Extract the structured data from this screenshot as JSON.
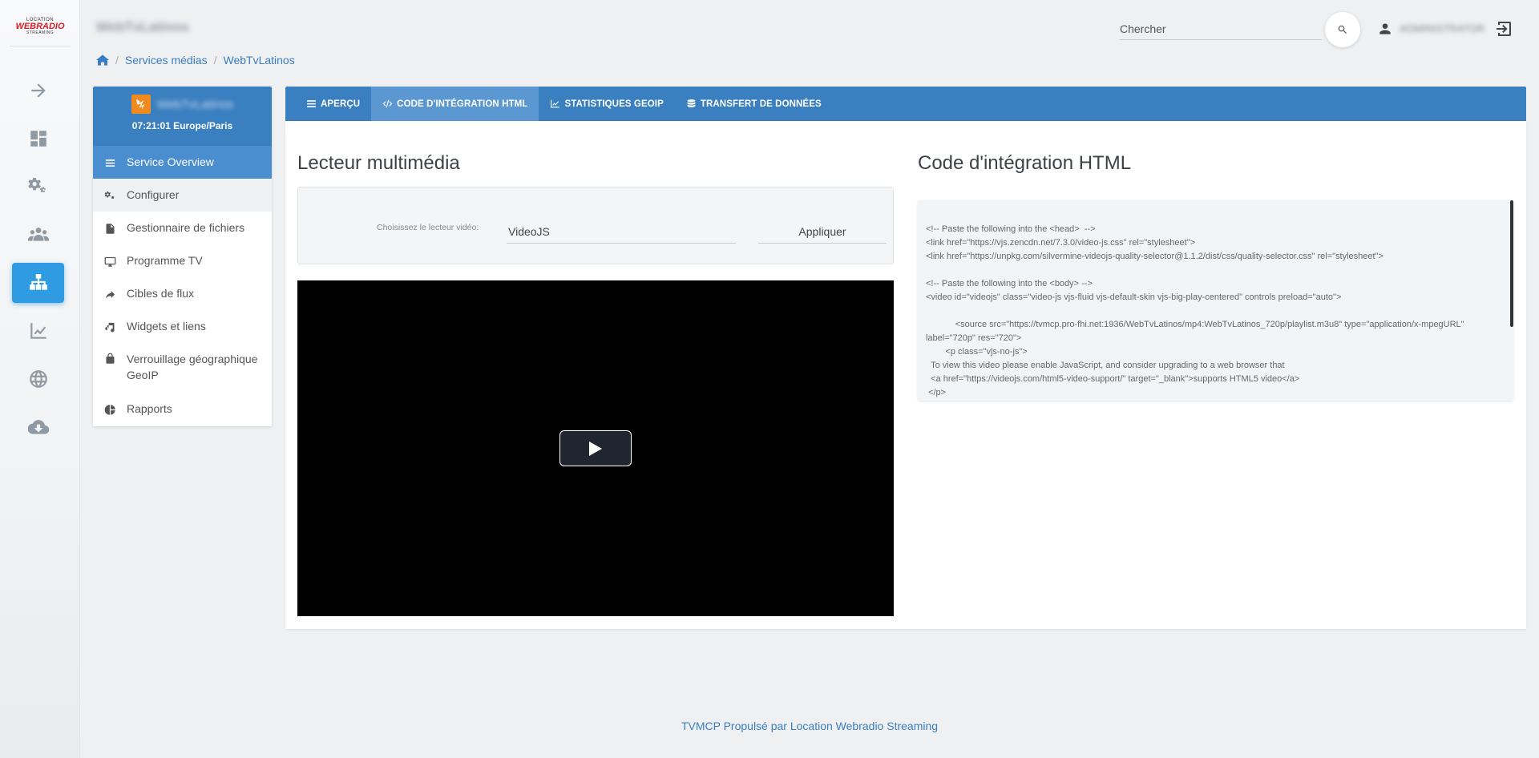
{
  "logo": {
    "line1": "LOCATION",
    "line2": "WEBRADIO",
    "line3": "STREAMING"
  },
  "header": {
    "brand": "WebTvLatinos",
    "search_placeholder": "Chercher",
    "user": "ADMINISTRATOR"
  },
  "breadcrumb": {
    "items": [
      "Services médias",
      "WebTvLatinos"
    ]
  },
  "service": {
    "name": "WebTvLatinos",
    "time": "07:21:01 Europe/Paris",
    "menu": [
      {
        "label": "Service Overview"
      },
      {
        "label": "Configurer"
      },
      {
        "label": "Gestionnaire de fichiers"
      },
      {
        "label": "Programme TV"
      },
      {
        "label": "Cibles de flux"
      },
      {
        "label": "Widgets et liens"
      },
      {
        "label": "Verrouillage géographique GeoIP"
      },
      {
        "label": "Rapports"
      }
    ]
  },
  "tabs": [
    {
      "label": "APERÇU",
      "icon": "list-icon"
    },
    {
      "label": "CODE D'INTÉGRATION HTML",
      "icon": "code-icon"
    },
    {
      "label": "STATISTIQUES GEOIP",
      "icon": "chart-icon"
    },
    {
      "label": "TRANSFERT DE DONNÉES",
      "icon": "database-icon"
    }
  ],
  "player": {
    "title": "Lecteur multimédia",
    "chooser_label": "Choisissez le lecteur vidéo:",
    "selected": "VideoJS",
    "apply": "Appliquer"
  },
  "embed": {
    "title": "Code d'intégration HTML",
    "code": "<!-- Paste the following into the <head>  -->\n<link href=\"https://vjs.zencdn.net/7.3.0/video-js.css\" rel=\"stylesheet\">\n<link href=\"https://unpkg.com/silvermine-videojs-quality-selector@1.1.2/dist/css/quality-selector.css\" rel=\"stylesheet\">\n\n<!-- Paste the following into the <body> -->\n<video id=\"videojs\" class=\"video-js vjs-fluid vjs-default-skin vjs-big-play-centered\" controls preload=\"auto\">\n\n            <source src=\"https://tvmcp.pro-fhi.net:1936/WebTvLatinos/mp4:WebTvLatinos_720p/playlist.m3u8\" type=\"application/x-mpegURL\" label=\"720p\" res=\"720\">\n        <p class=\"vjs-no-js\">\n  To view this video please enable JavaScript, and consider upgrading to a web browser that\n  <a href=\"https://videojs.com/html5-video-support/\" target=\"_blank\">supports HTML5 video</a>\n </p>"
  },
  "footer": {
    "text": "TVMCP Propulsé par Location Webradio Streaming"
  },
  "colors": {
    "primary": "#3a7fc0",
    "rail_active": "#2e9be2",
    "tab_active": "#5b98d2"
  }
}
